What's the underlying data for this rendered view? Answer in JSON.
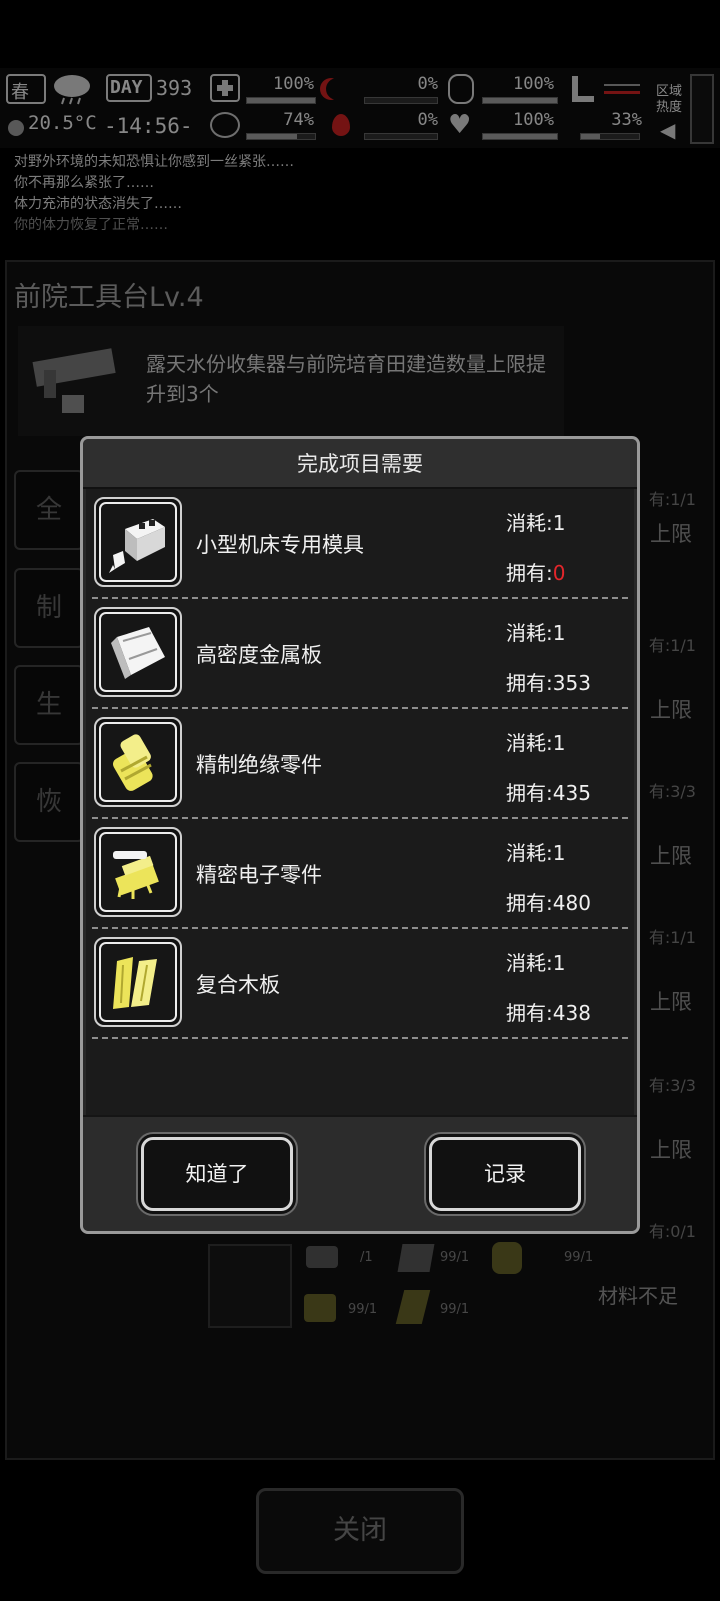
{
  "hud": {
    "season": "春",
    "temperature": "20.5°C",
    "day_label": "DAY",
    "day_number": "393",
    "clock": "-14:56-",
    "health_pct": "100%",
    "health_fill": 100,
    "hunger_pct": "74%",
    "hunger_fill": 74,
    "moon_pct": "0%",
    "moon_fill": 0,
    "blood_pct": "0%",
    "blood_fill": 0,
    "armor_pct": "100%",
    "armor_fill": 100,
    "heart_pct": "100%",
    "heart_fill": 100,
    "stamina_pct": "33%",
    "stamina_fill": 33,
    "region_label_1": "区域",
    "region_label_2": "热度"
  },
  "log": [
    "对野外环境的未知恐惧让你感到一丝紧张……",
    "你不再那么紧张了……",
    "体力充沛的状态消失了……",
    "你的体力恢复了正常……"
  ],
  "workbench": {
    "title": "前院工具台Lv.4",
    "description": "露天水份收集器与前院培育田建造数量上限提升到3个",
    "side_tabs": [
      "全",
      "制",
      "生",
      "恢"
    ],
    "right_counts": [
      "有:1/1",
      "有:1/1",
      "有:3/3",
      "有:1/1",
      "有:3/3",
      "有:0/1"
    ],
    "right_limits": [
      "上限",
      "上限",
      "上限",
      "上限",
      "上限"
    ],
    "recipe_counts": [
      "/1",
      "99/1",
      "99/1",
      "99/1",
      "99/1"
    ],
    "not_enough": "材料不足",
    "close_label": "关闭"
  },
  "dialog": {
    "title": "完成项目需要",
    "items": [
      {
        "name": "小型机床专用模具",
        "need": "消耗:1",
        "have_label": "拥有:",
        "have_value": "0",
        "icon": "machine-tool-mold-icon"
      },
      {
        "name": "高密度金属板",
        "need": "消耗:1",
        "have_label": "拥有:",
        "have_value": "353",
        "icon": "metal-plate-icon"
      },
      {
        "name": "精制绝缘零件",
        "need": "消耗:1",
        "have_label": "拥有:",
        "have_value": "435",
        "icon": "insulation-part-icon"
      },
      {
        "name": "精密电子零件",
        "need": "消耗:1",
        "have_label": "拥有:",
        "have_value": "480",
        "icon": "electronic-part-icon"
      },
      {
        "name": "复合木板",
        "need": "消耗:1",
        "have_label": "拥有:",
        "have_value": "438",
        "icon": "composite-wood-icon"
      }
    ],
    "ok_label": "知道了",
    "record_label": "记录"
  },
  "colors": {
    "insufficient": "#e3262b",
    "dialog_border": "#9a9a9a",
    "item_yellow": "#ece45a"
  }
}
